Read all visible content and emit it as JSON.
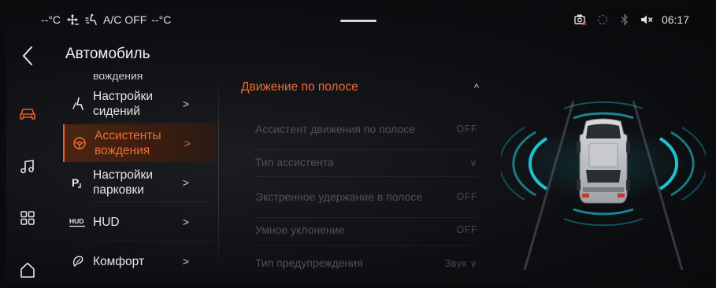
{
  "status_bar": {
    "temp_left": "--°C",
    "ac_status": "A/C OFF",
    "temp_right": "--°C",
    "time": "06:17"
  },
  "rail": {
    "icons": [
      "back-arrow-icon",
      "car-icon",
      "music-icon",
      "apps-grid-icon",
      "home-icon"
    ],
    "active": "car-icon",
    "accent": "#e3602c"
  },
  "category": {
    "title": "Автомобиль",
    "partial_item": "вождения",
    "items": [
      {
        "label": "Настройки сидений",
        "icon": "seat-icon"
      },
      {
        "label": "Ассистенты вождения",
        "icon": "steering-wheel-icon",
        "active": true
      },
      {
        "label": "Настройки парковки",
        "icon": "parking-icon"
      },
      {
        "label": "HUD",
        "icon": "hud-icon"
      },
      {
        "label": "Комфорт",
        "icon": "comfort-icon"
      }
    ],
    "chevron": ">"
  },
  "section": {
    "title": "Движение по полосе",
    "caret": "^",
    "settings": [
      {
        "label": "Ассистент движения по полосе",
        "value": "OFF"
      },
      {
        "label": "Тип ассистента",
        "value": "∨"
      },
      {
        "label": "Экстренное удержание в полосе",
        "value": "OFF"
      },
      {
        "label": "Умное уклонение",
        "value": "OFF"
      },
      {
        "label": "Тип предупреждения",
        "value": "Звук ∨"
      }
    ]
  },
  "colors": {
    "accent": "#ef6b35",
    "disabled_text": "#4f5257",
    "sensor_cyan": "#1fd6e6"
  }
}
